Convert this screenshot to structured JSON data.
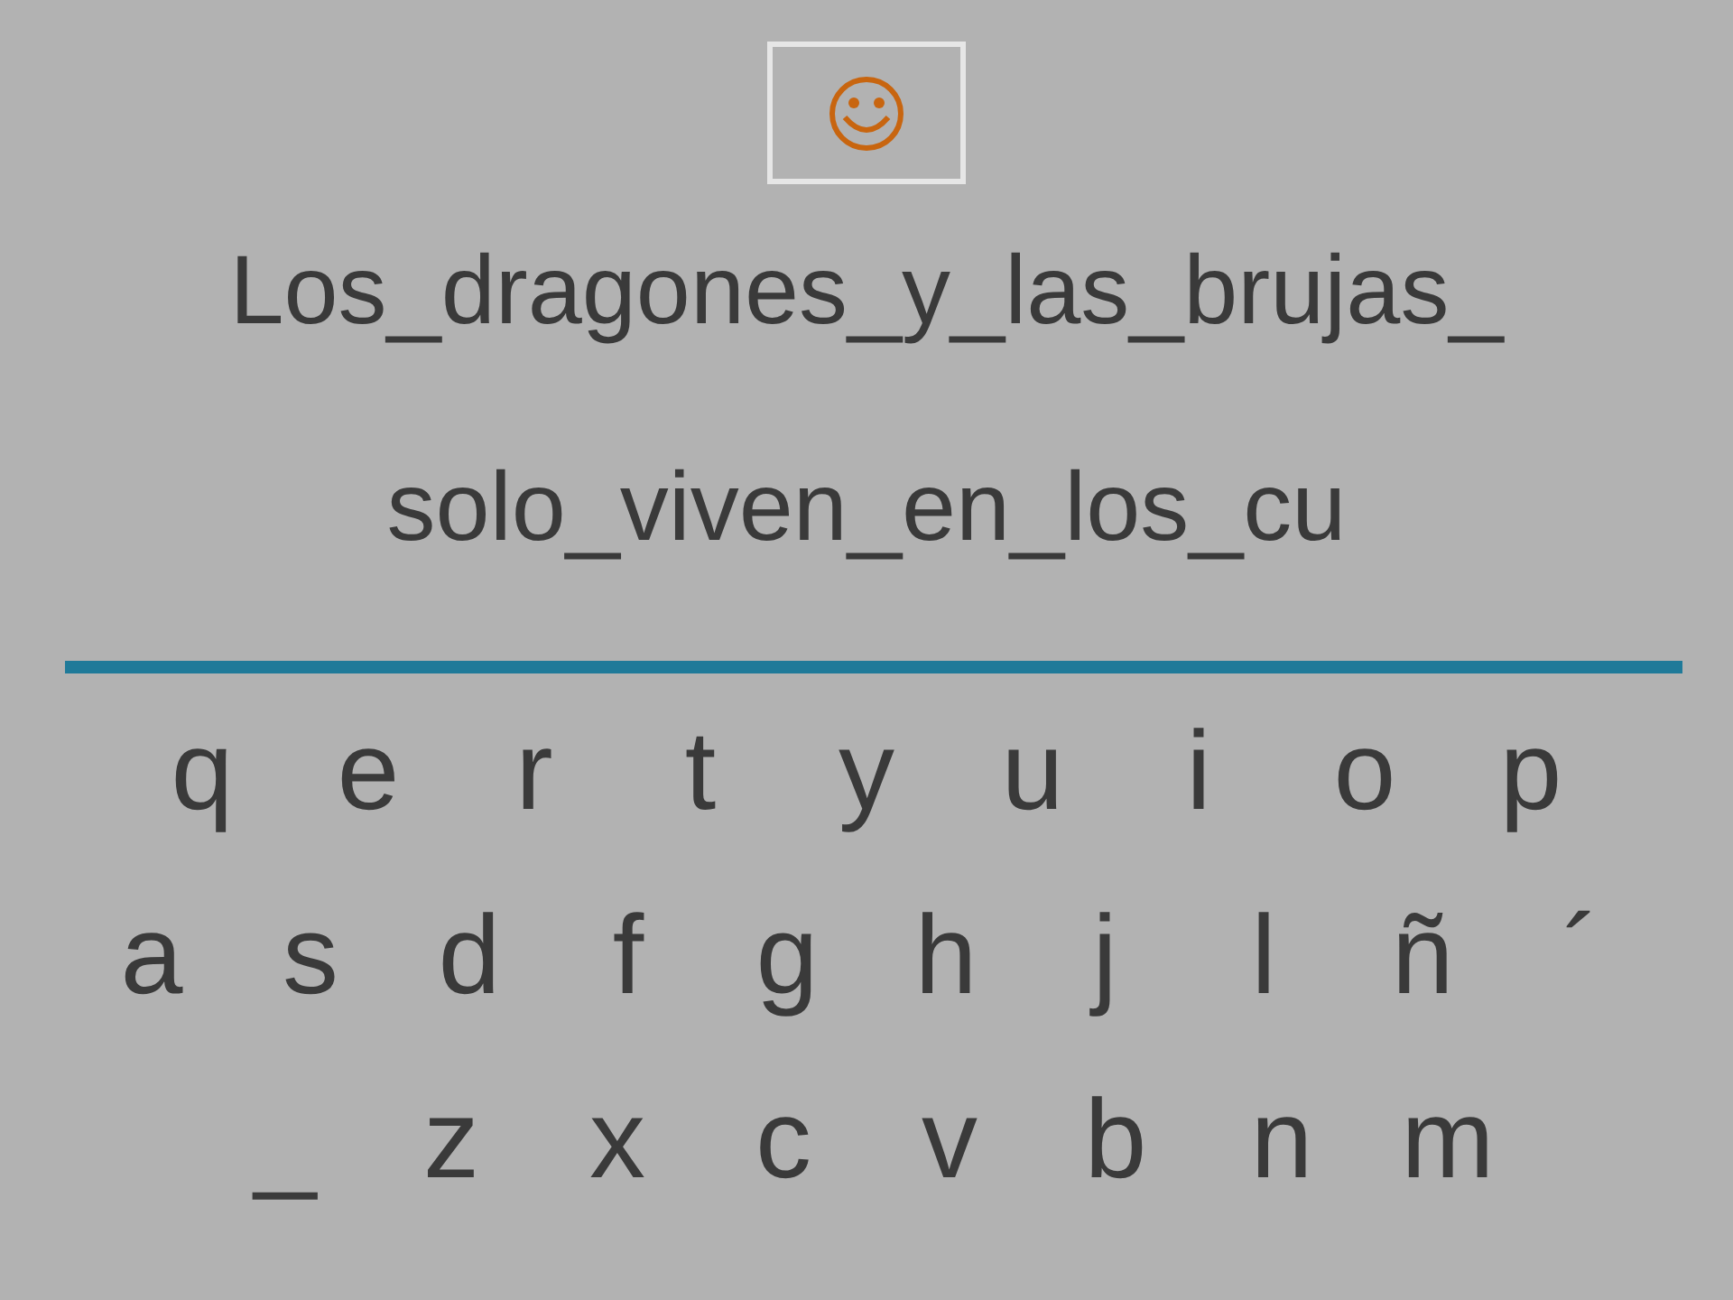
{
  "phrase_lines": [
    "Los_dragones_y_las_brujas_",
    "solo_viven_en_los_cu"
  ],
  "keyboard_rows": [
    [
      "q",
      "e",
      "r",
      "t",
      "y",
      "u",
      "i",
      "o",
      "p"
    ],
    [
      "a",
      "s",
      "d",
      "f",
      "g",
      "h",
      "j",
      "l",
      "ñ",
      "´"
    ],
    [
      "_",
      "z",
      "x",
      "c",
      "v",
      "b",
      "n",
      "m"
    ]
  ]
}
